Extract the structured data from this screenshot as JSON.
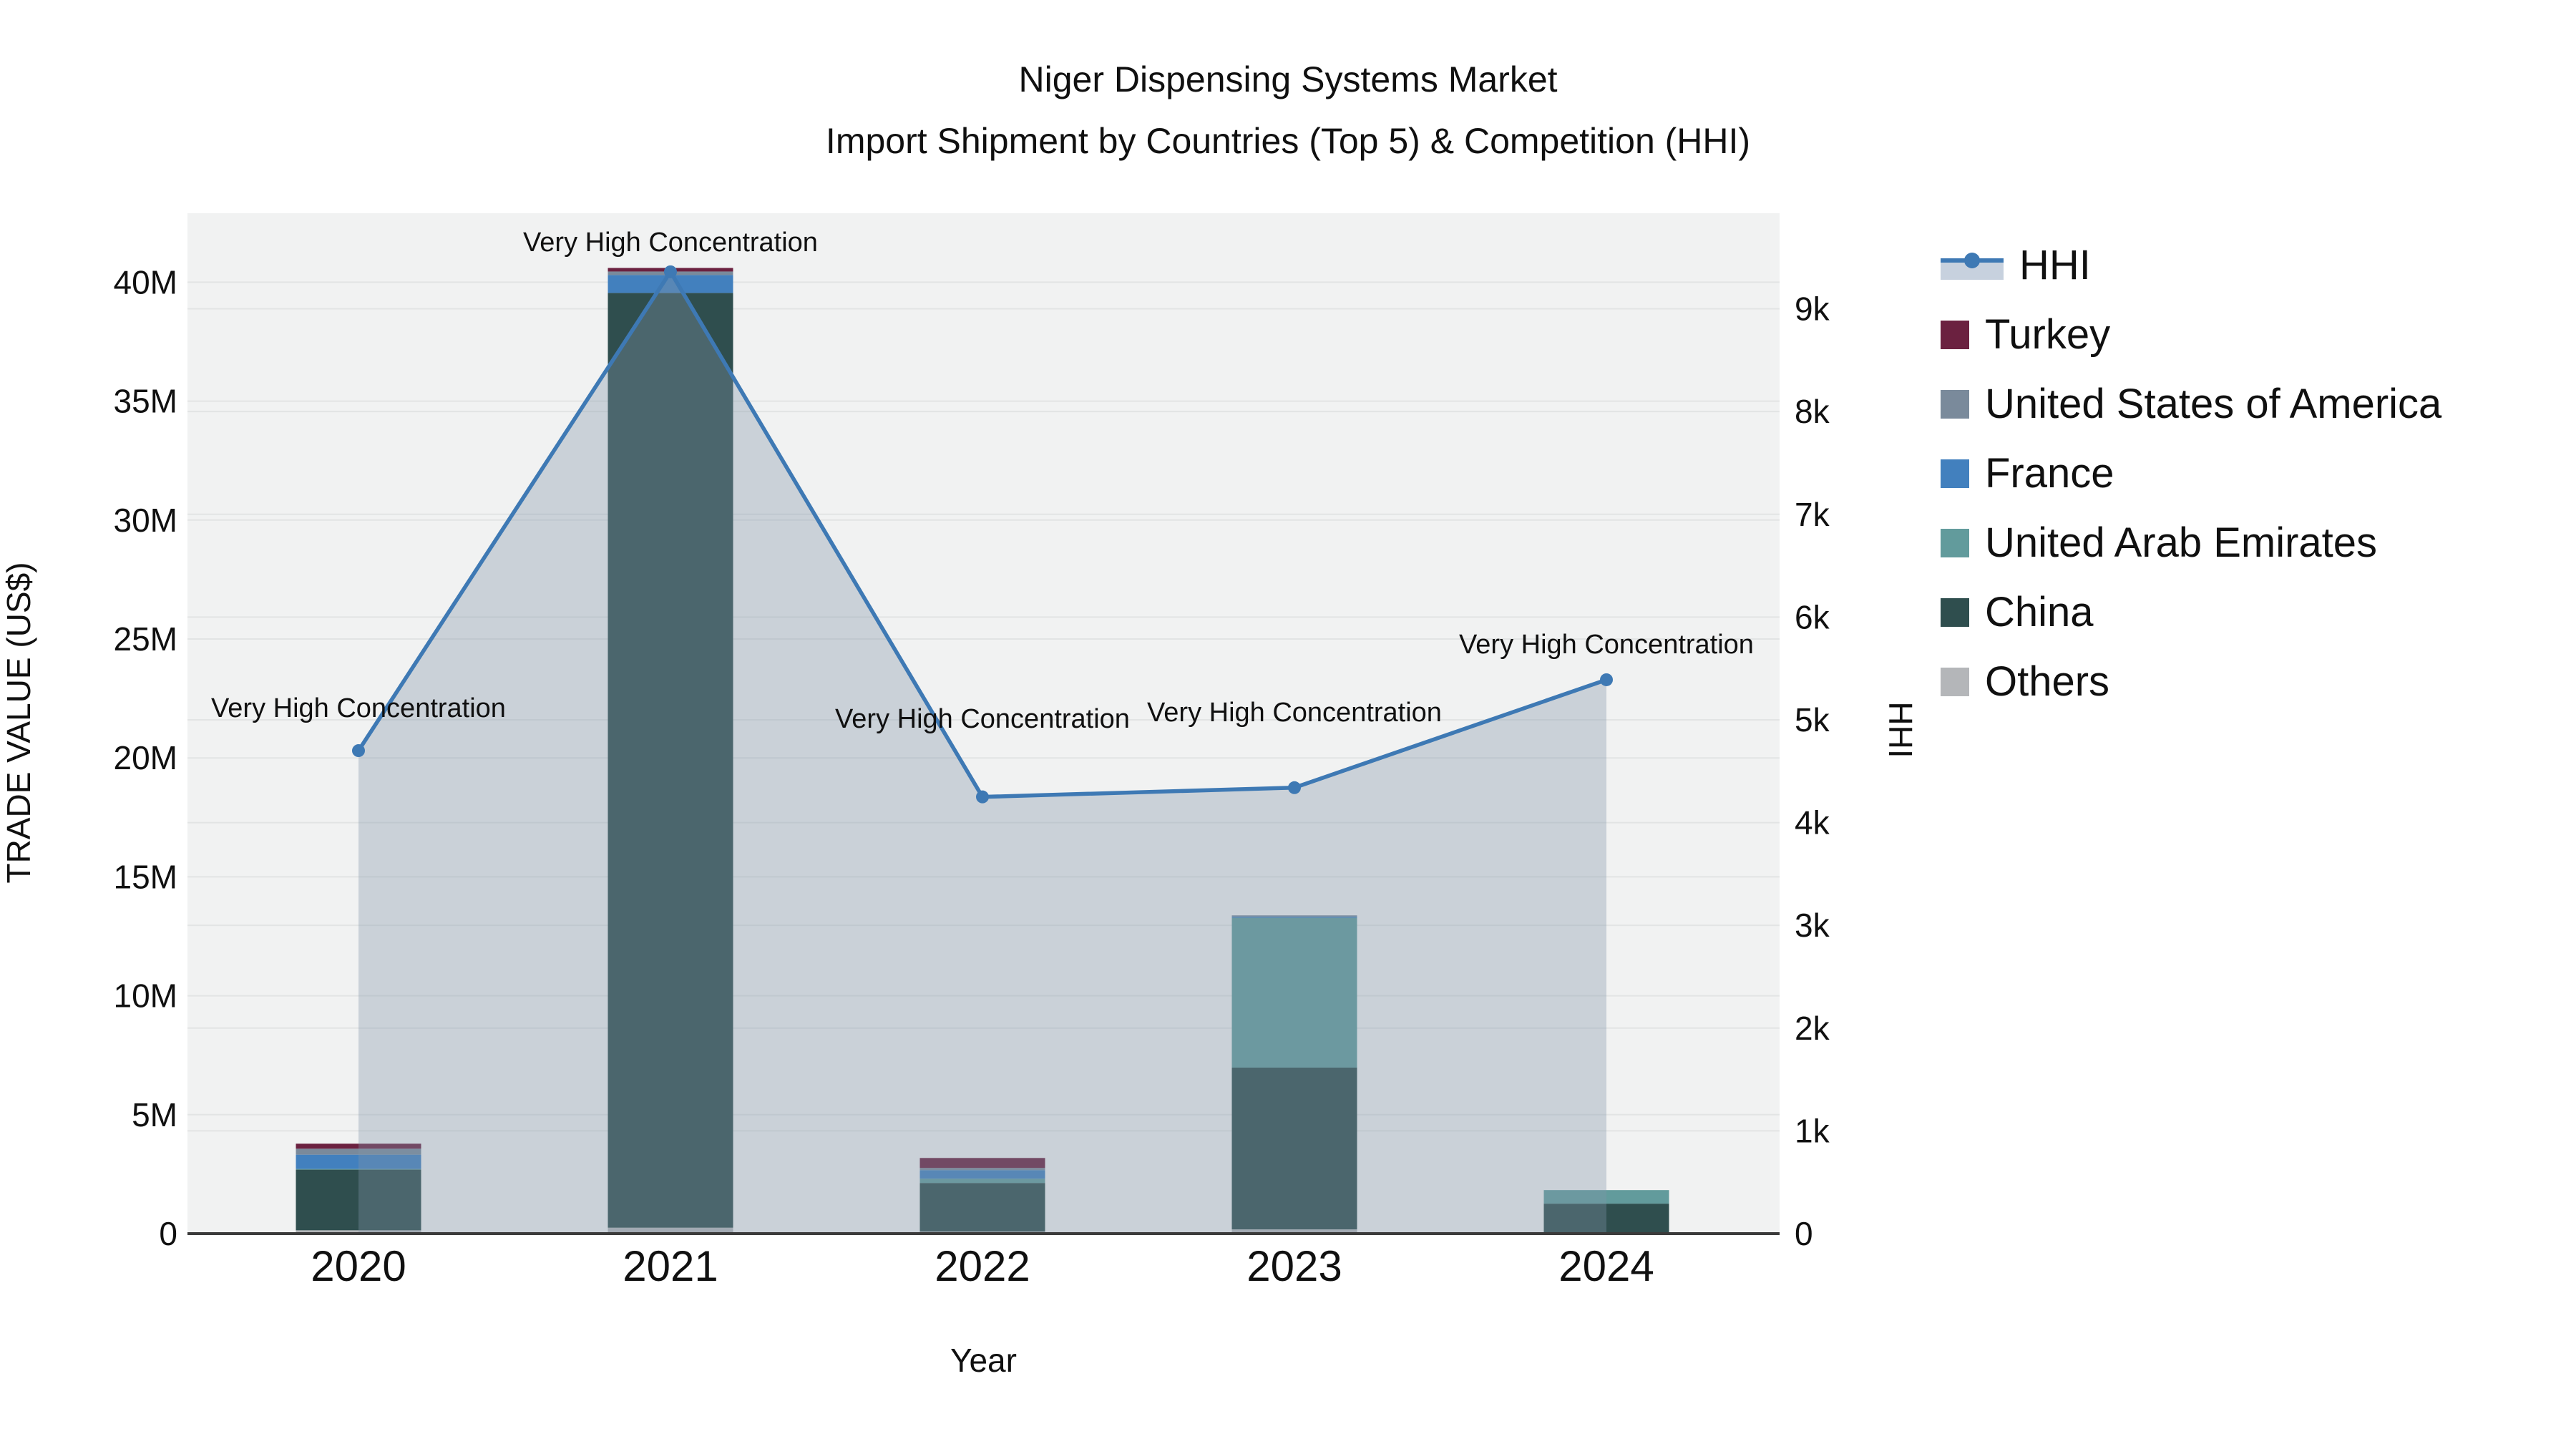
{
  "title": {
    "line1": "Niger Dispensing Systems Market",
    "line2": "Import Shipment by Countries (Top 5) & Competition (HHI)"
  },
  "colors": {
    "plot_bg": "#F1F2F2",
    "gridline": "#E2E4E4",
    "axis_line": "#3B3B3B",
    "text": "#101010",
    "hhi_line": "#3E79B4",
    "hhi_fill": "rgba(130,148,170,0.35)"
  },
  "legend": {
    "items": [
      {
        "label": "HHI",
        "type": "line",
        "color": "#3E79B4"
      },
      {
        "label": "Turkey",
        "type": "swatch",
        "color": "#6B2140"
      },
      {
        "label": "United States of America",
        "type": "swatch",
        "color": "#7A8A9B"
      },
      {
        "label": "France",
        "type": "swatch",
        "color": "#4280BE"
      },
      {
        "label": "United Arab Emirates",
        "type": "swatch",
        "color": "#629B9C"
      },
      {
        "label": "China",
        "type": "swatch",
        "color": "#2F4E4E"
      },
      {
        "label": "Others",
        "type": "swatch",
        "color": "#B4B6B9"
      }
    ]
  },
  "chart_data": {
    "type": "bar+line",
    "x": [
      "2020",
      "2021",
      "2022",
      "2023",
      "2024"
    ],
    "xlabel": "Year",
    "left_axis": {
      "title": "TRADE VALUE (US$)",
      "max_musd": 42.9,
      "ticks": [
        {
          "label": "0",
          "value": 0
        },
        {
          "label": "5M",
          "value": 5
        },
        {
          "label": "10M",
          "value": 10
        },
        {
          "label": "15M",
          "value": 15
        },
        {
          "label": "20M",
          "value": 20
        },
        {
          "label": "25M",
          "value": 25
        },
        {
          "label": "30M",
          "value": 30
        },
        {
          "label": "35M",
          "value": 35
        },
        {
          "label": "40M",
          "value": 40
        }
      ]
    },
    "right_axis": {
      "title": "HHI",
      "max": 9930,
      "ticks": [
        {
          "label": "0",
          "value": 0
        },
        {
          "label": "1k",
          "value": 1000
        },
        {
          "label": "2k",
          "value": 2000
        },
        {
          "label": "3k",
          "value": 3000
        },
        {
          "label": "4k",
          "value": 4000
        },
        {
          "label": "5k",
          "value": 5000
        },
        {
          "label": "6k",
          "value": 6000
        },
        {
          "label": "7k",
          "value": 7000
        },
        {
          "label": "8k",
          "value": 8000
        },
        {
          "label": "9k",
          "value": 9000
        }
      ]
    },
    "stack_order_bottom_to_top": [
      "Others",
      "China",
      "United Arab Emirates",
      "France",
      "United States of America",
      "Turkey"
    ],
    "series": [
      {
        "name": "Turkey",
        "color": "#6B2140",
        "values_musd": [
          0.21,
          0.15,
          0.42,
          0.0,
          0.0
        ]
      },
      {
        "name": "United States of America",
        "color": "#7A8A9B",
        "values_musd": [
          0.25,
          0.15,
          0.09,
          0.05,
          0.0
        ]
      },
      {
        "name": "France",
        "color": "#4280BE",
        "values_musd": [
          0.6,
          0.75,
          0.36,
          0.05,
          0.0
        ]
      },
      {
        "name": "United Arab Emirates",
        "color": "#629B9C",
        "values_musd": [
          0.03,
          0.0,
          0.18,
          6.3,
          0.57
        ]
      },
      {
        "name": "China",
        "color": "#2F4E4E",
        "values_musd": [
          2.55,
          39.3,
          2.04,
          6.8,
          1.2
        ]
      },
      {
        "name": "Others",
        "color": "#B4B6B9",
        "values_musd": [
          0.14,
          0.25,
          0.09,
          0.18,
          0.06
        ]
      }
    ],
    "totals_musd": [
      3.78,
      40.6,
      3.18,
      13.38,
      1.83
    ],
    "hhi": {
      "name": "HHI",
      "values": [
        4700,
        9360,
        4250,
        4340,
        5390
      ]
    },
    "annotations": [
      {
        "year": "2020",
        "text": "Very High Concentration",
        "baseline_y": 1002
      },
      {
        "year": "2021",
        "text": "Very High Concentration",
        "baseline_y": 351
      },
      {
        "year": "2022",
        "text": "Very High Concentration",
        "baseline_y": 1017
      },
      {
        "year": "2023",
        "text": "Very High Concentration",
        "baseline_y": 1008
      },
      {
        "year": "2024",
        "text": "Very High Concentration",
        "baseline_y": 913
      }
    ],
    "legend_position": "right",
    "grid": true
  }
}
